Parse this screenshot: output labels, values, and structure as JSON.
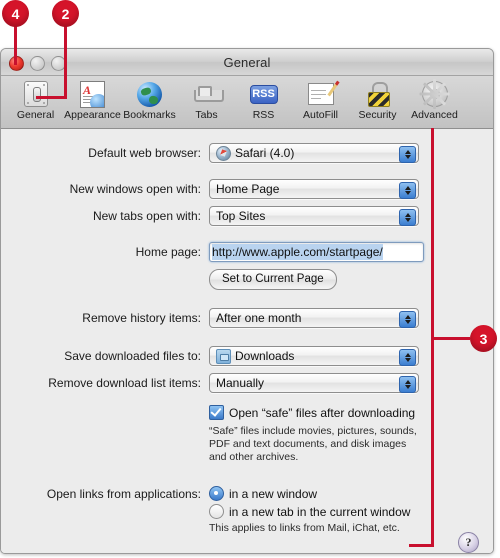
{
  "callouts": [
    {
      "num": "4",
      "name": "callout-4"
    },
    {
      "num": "2",
      "name": "callout-2"
    },
    {
      "num": "3",
      "name": "callout-3"
    }
  ],
  "window": {
    "title": "General",
    "traffic_lights": [
      "close",
      "minimize",
      "zoom"
    ]
  },
  "toolbar": {
    "items": [
      {
        "label": "General",
        "icon": "general-icon",
        "selected": true
      },
      {
        "label": "Appearance",
        "icon": "appearance-icon",
        "selected": false
      },
      {
        "label": "Bookmarks",
        "icon": "bookmarks-globe-icon",
        "selected": false
      },
      {
        "label": "Tabs",
        "icon": "tabs-icon",
        "selected": false
      },
      {
        "label": "RSS",
        "icon": "rss-icon",
        "selected": false
      },
      {
        "label": "AutoFill",
        "icon": "autofill-icon",
        "selected": false
      },
      {
        "label": "Security",
        "icon": "lock-icon",
        "selected": false
      },
      {
        "label": "Advanced",
        "icon": "gear-icon",
        "selected": false
      }
    ],
    "rss_badge_text": "RSS",
    "appearance_letter": "A"
  },
  "form": {
    "default_browser": {
      "label": "Default web browser:",
      "value": "Safari (4.0)",
      "icon": "safari-icon"
    },
    "new_windows": {
      "label": "New windows open with:",
      "value": "Home Page"
    },
    "new_tabs": {
      "label": "New tabs open with:",
      "value": "Top Sites"
    },
    "home_page": {
      "label": "Home page:",
      "value": "http://www.apple.com/startpage/"
    },
    "set_current": {
      "button_label": "Set to Current Page"
    },
    "remove_history": {
      "label": "Remove history items:",
      "value": "After one month"
    },
    "save_downloads": {
      "label": "Save downloaded files to:",
      "value": "Downloads",
      "icon": "folder-icon"
    },
    "remove_download_list": {
      "label": "Remove download list items:",
      "value": "Manually"
    },
    "open_safe": {
      "checkbox_label": "Open “safe” files after downloading",
      "checked": true,
      "note_line1": "“Safe” files include movies, pictures, sounds,",
      "note_line2": "PDF and text documents, and disk images",
      "note_line3": "and other archives."
    },
    "open_links": {
      "label": "Open links from applications:",
      "option1": "in a new window",
      "option2": "in a new tab in the current window",
      "selected": "option1",
      "note": "This applies to links from Mail, iChat, etc."
    }
  },
  "help": {
    "label": "?"
  },
  "colors": {
    "callout_red": "#d5142a",
    "accent_blue": "#3a79c9",
    "window_bg": "#ececec"
  }
}
